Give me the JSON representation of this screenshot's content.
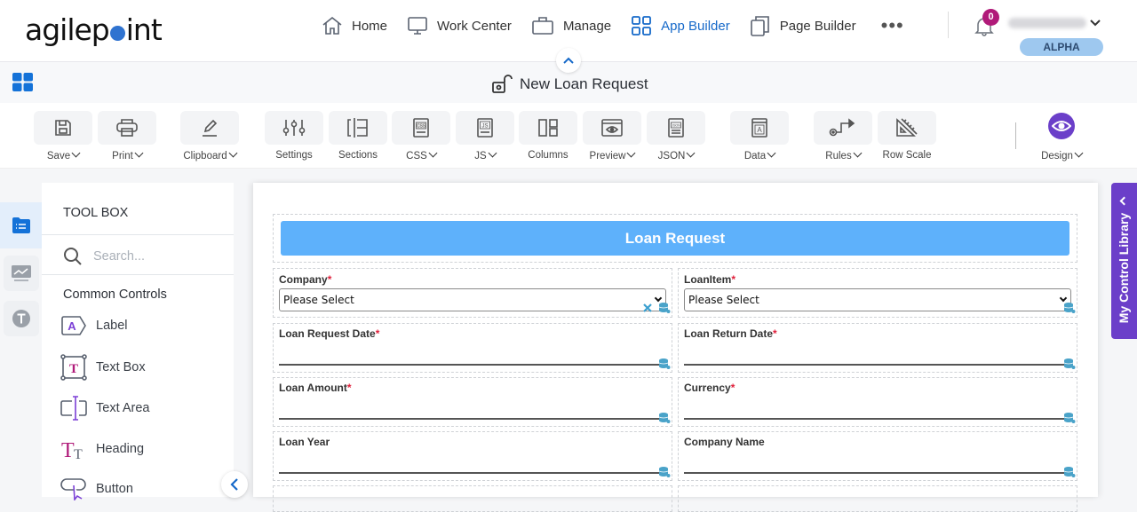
{
  "brand": {
    "logo_prefix": "agilep",
    "logo_suffix": "int"
  },
  "topnav": {
    "items": [
      {
        "label": "Home",
        "icon": "home-icon",
        "active": false
      },
      {
        "label": "Work Center",
        "icon": "monitor-icon",
        "active": false
      },
      {
        "label": "Manage",
        "icon": "briefcase-icon",
        "active": false
      },
      {
        "label": "App Builder",
        "icon": "grid-icon",
        "active": true
      },
      {
        "label": "Page Builder",
        "icon": "pages-icon",
        "active": false
      }
    ],
    "more_label": "•••",
    "notification_count": "0",
    "environment_badge": "ALPHA"
  },
  "titlebar": {
    "title": "New Loan Request"
  },
  "toolbar": {
    "items": [
      {
        "label": "Save",
        "dropdown": true
      },
      {
        "label": "Print",
        "dropdown": true
      },
      {
        "label": "Clipboard",
        "dropdown": true
      },
      {
        "label": "Settings",
        "dropdown": false
      },
      {
        "label": "Sections",
        "dropdown": false
      },
      {
        "label": "CSS",
        "dropdown": true
      },
      {
        "label": "JS",
        "dropdown": true
      },
      {
        "label": "Columns",
        "dropdown": false
      },
      {
        "label": "Preview",
        "dropdown": true
      },
      {
        "label": "JSON",
        "dropdown": true
      },
      {
        "label": "Data",
        "dropdown": true
      },
      {
        "label": "Rules",
        "dropdown": true
      },
      {
        "label": "Row Scale",
        "dropdown": false
      }
    ],
    "design_label": "Design"
  },
  "toolbox": {
    "title": "TOOL BOX",
    "search_placeholder": "Search...",
    "group_label": "Common Controls",
    "items": [
      {
        "label": "Label"
      },
      {
        "label": "Text Box"
      },
      {
        "label": "Text Area"
      },
      {
        "label": "Heading"
      },
      {
        "label": "Button"
      }
    ]
  },
  "form": {
    "header": "Loan Request",
    "fields": [
      {
        "label": "Company",
        "required": true,
        "type": "select",
        "value": "Please Select"
      },
      {
        "label": "LoanItem",
        "required": true,
        "type": "select",
        "value": "Please Select"
      },
      {
        "label": "Loan Request Date",
        "required": true,
        "type": "text",
        "value": ""
      },
      {
        "label": "Loan Return Date",
        "required": true,
        "type": "text",
        "value": ""
      },
      {
        "label": "Loan Amount",
        "required": true,
        "type": "text",
        "value": ""
      },
      {
        "label": "Currency",
        "required": true,
        "type": "text",
        "value": ""
      },
      {
        "label": "Loan Year",
        "required": false,
        "type": "text",
        "value": ""
      },
      {
        "label": "Company Name",
        "required": false,
        "type": "text",
        "value": ""
      }
    ],
    "required_mark": "*"
  },
  "right_panel": {
    "label": "My Control Library"
  },
  "colors": {
    "accent": "#1669c9",
    "purple": "#6b3fc9",
    "header_bar": "#5eb1fb",
    "badge": "#b01a79"
  }
}
